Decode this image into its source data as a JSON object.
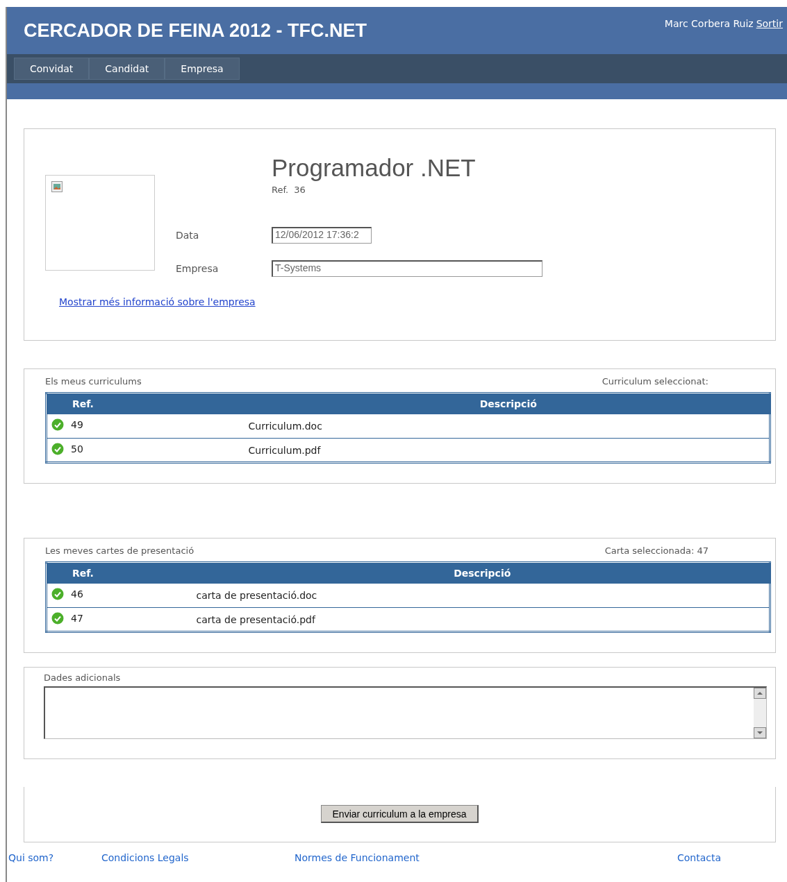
{
  "header": {
    "title": "CERCADOR DE FEINA 2012 - TFC.NET",
    "user": "Marc Corbera Ruiz",
    "logout": "Sortir"
  },
  "nav": [
    {
      "label": "Convidat"
    },
    {
      "label": "Candidat"
    },
    {
      "label": "Empresa"
    }
  ],
  "offer": {
    "title": "Programador .NET",
    "ref_label": "Ref.",
    "ref": "36",
    "fields": [
      {
        "label": "Data",
        "value": "12/06/2012 17:36:2",
        "kind": "short"
      },
      {
        "label": "Empresa",
        "value": "T-Systems",
        "kind": "long"
      }
    ],
    "link": "Mostrar més informació sobre l'empresa"
  },
  "cv_section": {
    "title": "Els meus curriculums",
    "selected_label": "Curriculum seleccionat:",
    "columns": [
      "Ref.",
      "Descripció"
    ],
    "rows": [
      {
        "ref": "49",
        "description": "Curriculum.doc"
      },
      {
        "ref": "50",
        "description": "Curriculum.pdf"
      }
    ]
  },
  "letter_section": {
    "title": "Les meves cartes de presentació",
    "selected_label": "Carta seleccionada: 47",
    "columns": [
      "Ref.",
      "Descripció"
    ],
    "rows": [
      {
        "ref": "46",
        "description": "carta de presentació.doc"
      },
      {
        "ref": "47",
        "description": "carta de presentació.pdf"
      }
    ]
  },
  "extra": {
    "label": "Dades adicionals"
  },
  "submit": "Enviar curriculum a la empresa",
  "footer": [
    "Qui som?",
    "Condicions Legals",
    "Normes de Funcionament",
    "Contacta"
  ]
}
